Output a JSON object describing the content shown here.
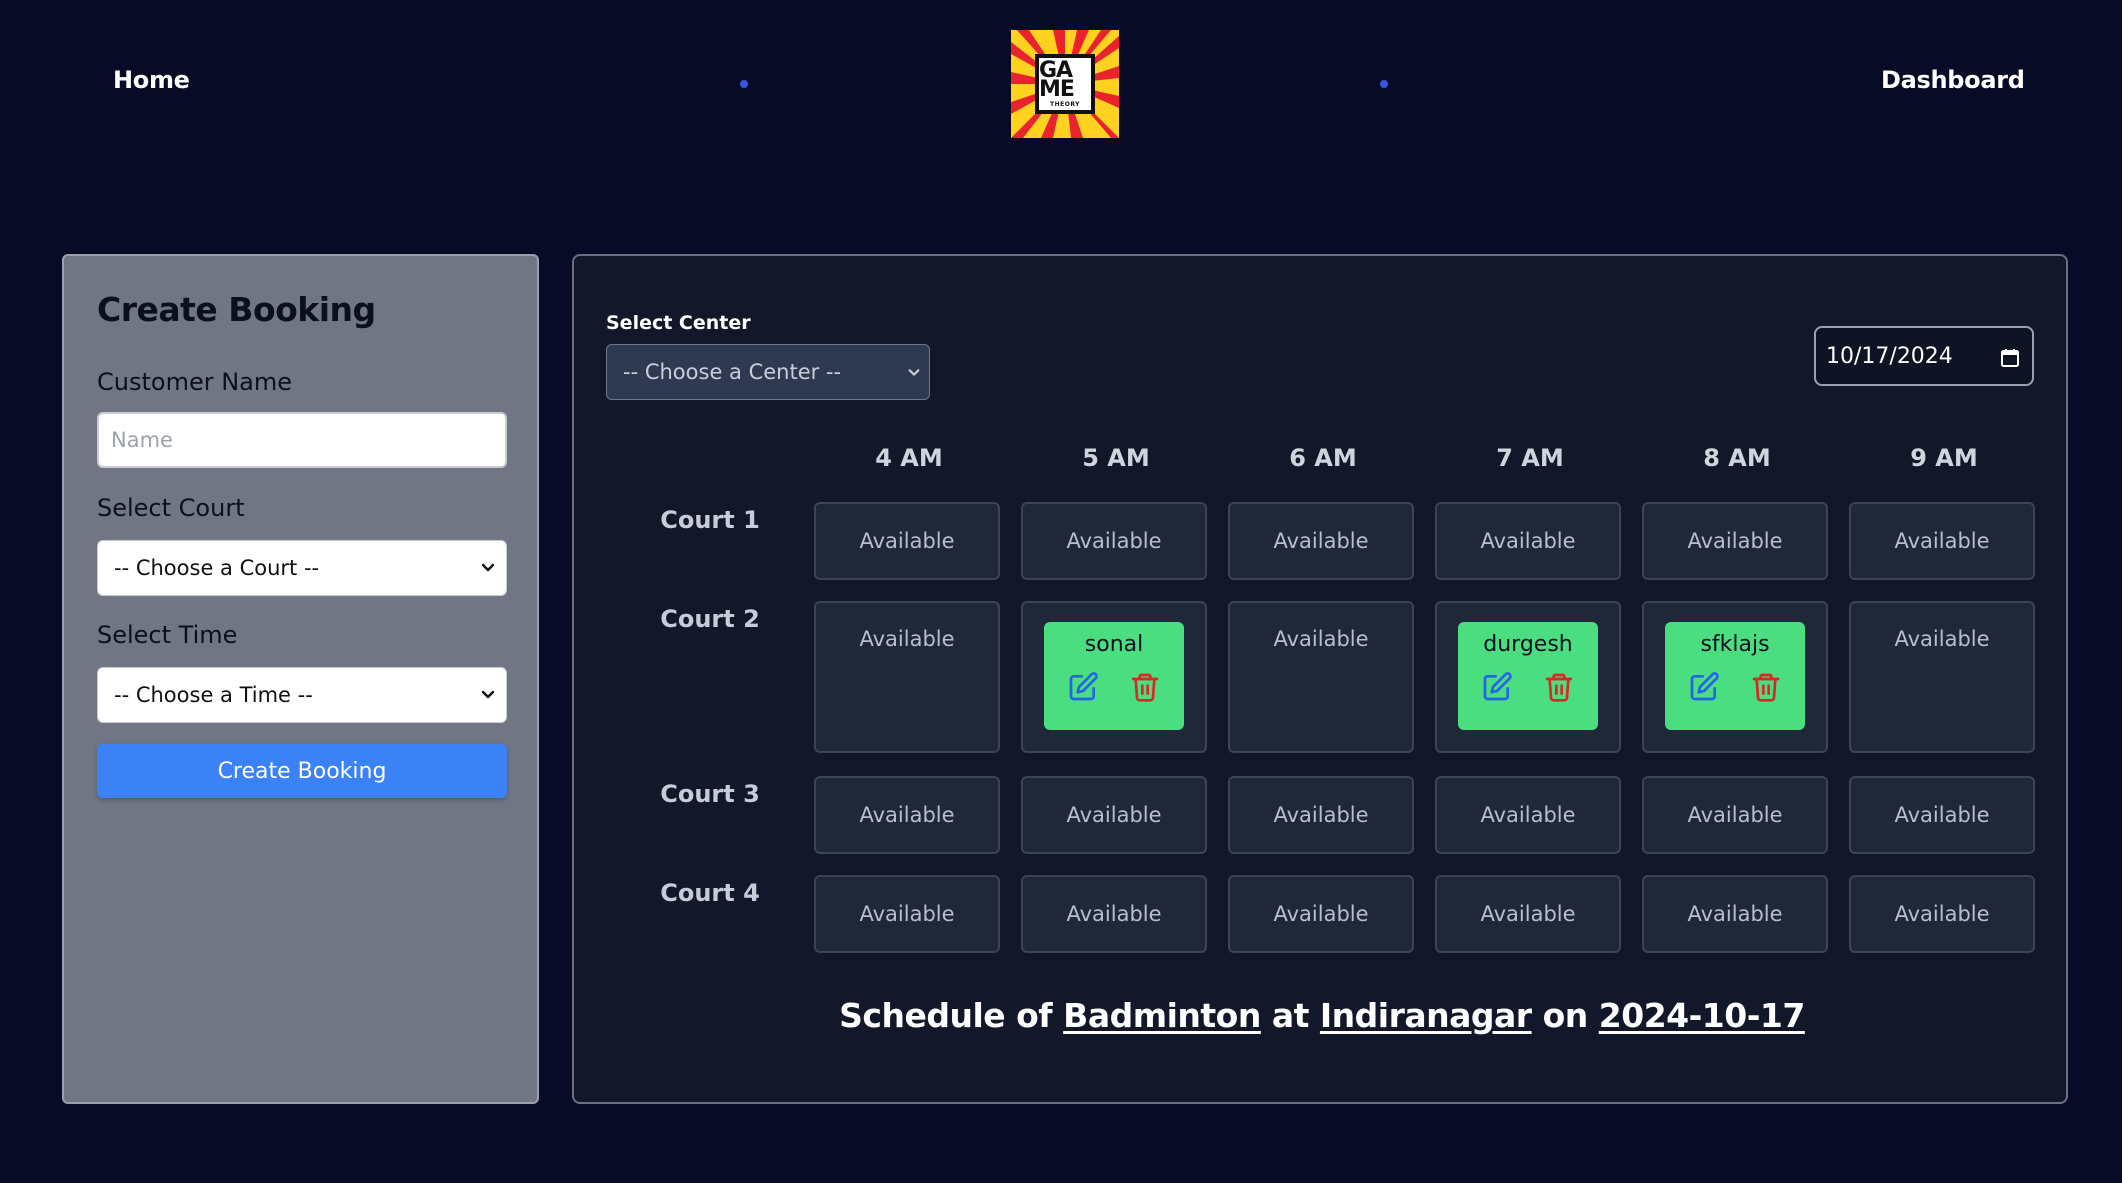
{
  "nav": {
    "home_label": "Home",
    "dashboard_label": "Dashboard",
    "logo_text_line1": "GA ME",
    "logo_text_line2": "THEORY"
  },
  "create_booking": {
    "title": "Create Booking",
    "customer_name_label": "Customer Name",
    "customer_name_placeholder": "Name",
    "customer_name_value": "",
    "court_label": "Select Court",
    "court_selected": "-- Choose a Court --",
    "time_label": "Select Time",
    "time_selected": "-- Choose a Time --",
    "submit_label": "Create Booking"
  },
  "schedule": {
    "center_label": "Select Center",
    "center_selected": "-- Choose a Center --",
    "date_value": "10/17/2024",
    "times": [
      "4 AM",
      "5 AM",
      "6 AM",
      "7 AM",
      "8 AM",
      "9 AM"
    ],
    "available_label": "Available",
    "courts": [
      {
        "name": "Court 1",
        "slots": [
          "Available",
          "Available",
          "Available",
          "Available",
          "Available",
          "Available"
        ]
      },
      {
        "name": "Court 2",
        "slots": [
          "Available",
          "sonal",
          "Available",
          "durgesh",
          "sfklajs",
          "Available"
        ]
      },
      {
        "name": "Court 3",
        "slots": [
          "Available",
          "Available",
          "Available",
          "Available",
          "Available",
          "Available"
        ]
      },
      {
        "name": "Court 4",
        "slots": [
          "Available",
          "Available",
          "Available",
          "Available",
          "Available",
          "Available"
        ]
      }
    ],
    "summary": {
      "prefix": "Schedule of",
      "sport": "Badminton",
      "at": "at",
      "center": "Indiranagar",
      "on": "on",
      "date": "2024-10-17"
    }
  },
  "colors": {
    "background": "#070b25",
    "booking_green": "#4ade80",
    "primary_blue": "#3b82f6",
    "edit_icon": "#2563eb",
    "delete_icon": "#dc2626"
  },
  "icons": {
    "edit": "pencil-square-icon",
    "delete": "trash-icon",
    "calendar": "calendar-icon",
    "dropdown": "chevron-down-icon"
  }
}
